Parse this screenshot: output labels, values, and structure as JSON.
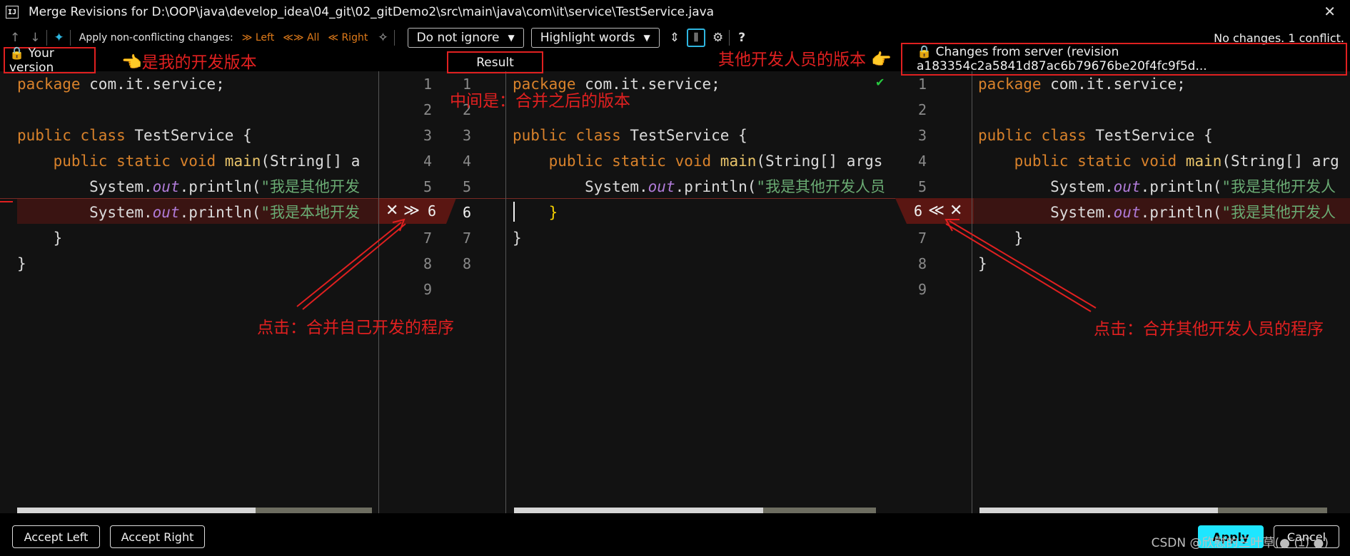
{
  "window": {
    "app_icon": "IJ",
    "title": "Merge Revisions for D:\\OOP\\java\\develop_idea\\04_git\\02_gitDemo2\\src\\main\\java\\com\\it\\service\\TestService.java",
    "close": "✕"
  },
  "toolbar": {
    "up_icon": "↑",
    "down_icon": "↓",
    "magic_icon": "✦",
    "apply_label": "Apply non-conflicting changes:",
    "left_label": "≫ Left",
    "all_label": "≪≫ All",
    "right_label": "≪ Right",
    "wand_icon": "✧",
    "ignore_dropdown": "Do not ignore",
    "highlight_dropdown": "Highlight words",
    "collapse_icon": "⇕",
    "sync_icon": "⫼",
    "settings_icon": "⚙",
    "help_icon": "?",
    "status": "No changes. 1 conflict."
  },
  "headers": {
    "left": "🔒 Your version",
    "middle": "Result",
    "right": "🔒 Changes from server (revision a183354c2a5841d87ac6b79676be20f4fc9f5d..."
  },
  "annotations": {
    "left_header": "👈是我的开发版本",
    "middle": "中间是：合并之后的版本",
    "right_header": "其他开发人员的版本 👉",
    "left_click": "点击：合并自己开发的程序",
    "right_click": "点击：合并其他开发人员的程序"
  },
  "left_pane": {
    "lines": [
      {
        "n": 1,
        "kw": "package",
        "rest": " com.it.service;"
      },
      {
        "n": 2,
        "kw": "",
        "rest": ""
      },
      {
        "n": 3,
        "kw": "public class",
        "rest": " TestService {"
      },
      {
        "n": 4,
        "pre": "    ",
        "kw": "public static void",
        "fn": " main",
        "rest": "(String[] a"
      },
      {
        "n": 5,
        "pre": "        System.",
        "it": "out",
        "rest": ".println(",
        "str": "\"我是其他开发"
      },
      {
        "n": 6,
        "pre": "        System.",
        "it": "out",
        "rest": ".println(",
        "str": "\"我是本地开发"
      },
      {
        "n": 7,
        "kw": "",
        "rest": "    }"
      },
      {
        "n": 8,
        "kw": "",
        "rest": "}"
      },
      {
        "n": 9,
        "kw": "",
        "rest": ""
      }
    ]
  },
  "middle_pane": {
    "lines": [
      {
        "n": 1,
        "kw": "package",
        "rest": " com.it.service;"
      },
      {
        "n": 2,
        "kw": "",
        "rest": ""
      },
      {
        "n": 3,
        "kw": "public class",
        "rest": " TestService {"
      },
      {
        "n": 4,
        "pre": "    ",
        "kw": "public static void",
        "fn": " main",
        "rest": "(String[] args"
      },
      {
        "n": 5,
        "pre": "        System.",
        "it": "out",
        "rest": ".println(",
        "str": "\"我是其他开发人员"
      },
      {
        "n": 6,
        "kw": "",
        "rest": "",
        "brace": "    }"
      },
      {
        "n": 7,
        "kw": "",
        "rest": "}"
      },
      {
        "n": 8,
        "kw": "",
        "rest": ""
      }
    ],
    "check": "✔"
  },
  "right_pane": {
    "lines": [
      {
        "n": 1,
        "kw": "package",
        "rest": " com.it.service;"
      },
      {
        "n": 2,
        "kw": "",
        "rest": ""
      },
      {
        "n": 3,
        "kw": "public class",
        "rest": " TestService {"
      },
      {
        "n": 4,
        "pre": "    ",
        "kw": "public static void",
        "fn": " main",
        "rest": "(String[] arg"
      },
      {
        "n": 5,
        "pre": "        System.",
        "it": "out",
        "rest": ".println(",
        "str": "\"我是其他开发人"
      },
      {
        "n": 6,
        "pre": "        System.",
        "it": "out",
        "rest": ".println(",
        "str": "\"我是其他开发人"
      },
      {
        "n": 7,
        "kw": "",
        "rest": "    }"
      },
      {
        "n": 8,
        "kw": "",
        "rest": "}"
      },
      {
        "n": 9,
        "kw": "",
        "rest": ""
      }
    ]
  },
  "gutter": {
    "reject_icon": "✕",
    "accept_left_icon": "≫",
    "accept_right_icon": "≪"
  },
  "bottom": {
    "accept_left": "Accept Left",
    "accept_right": "Accept Right",
    "apply": "Apply",
    "cancel": "Cancel",
    "watermark": "CSDN @欣慰的三叶草(● ̄(ｴ) ̄●)"
  }
}
